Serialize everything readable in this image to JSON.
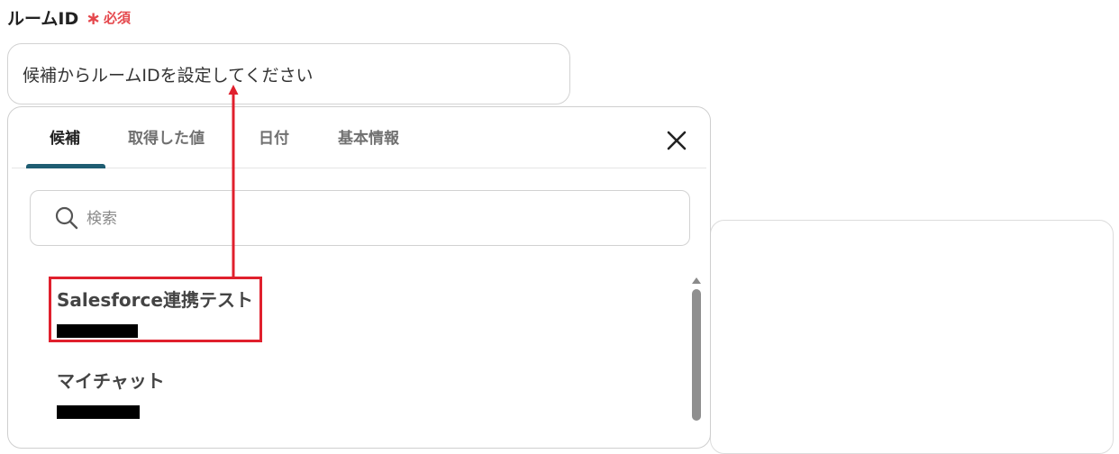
{
  "field": {
    "label": "ルームID",
    "required_mark": "∗",
    "required_text": "必須"
  },
  "room_input": {
    "placeholder": "候補からルームIDを設定してください"
  },
  "dropdown": {
    "tabs": [
      {
        "label": "候補",
        "active": true
      },
      {
        "label": "取得した値",
        "active": false
      },
      {
        "label": "日付",
        "active": false
      },
      {
        "label": "基本情報",
        "active": false
      }
    ],
    "search": {
      "placeholder": "検索",
      "value": ""
    },
    "options": [
      {
        "name": "Salesforce連携テスト",
        "id_redacted": true
      },
      {
        "name": "マイチャット",
        "id_redacted": true
      }
    ]
  },
  "icons": {
    "close": "close-icon",
    "search": "search-icon",
    "scroll_up": "scroll-up-arrow-icon"
  },
  "colors": {
    "required": "#e5484d",
    "tab_accent": "#1f5d72",
    "annotation": "#e0202d"
  }
}
